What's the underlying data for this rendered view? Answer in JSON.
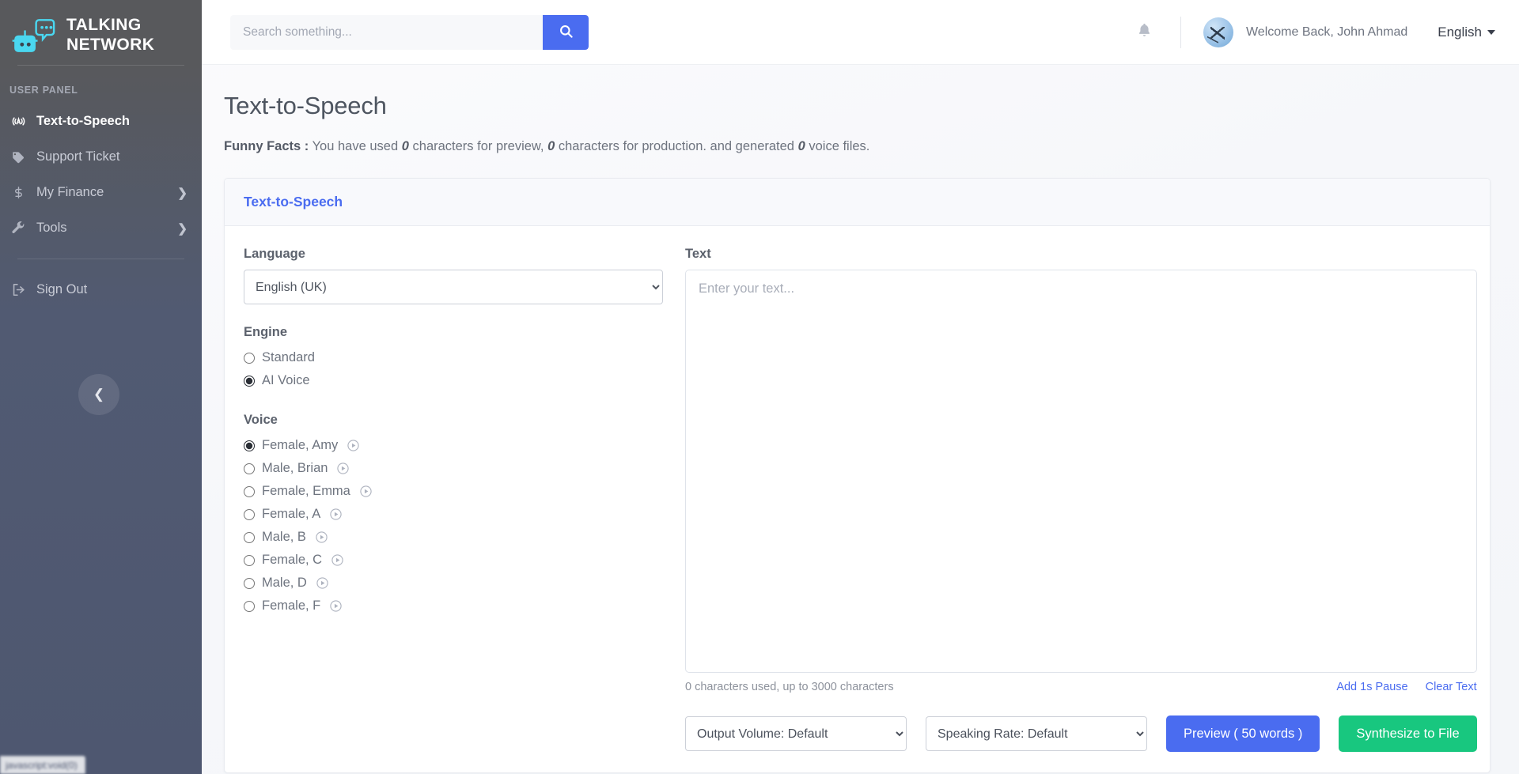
{
  "sidebar": {
    "brand": {
      "line1": "TALKING",
      "line2": "NETWORK",
      "logo_icon": "chatbot-icon"
    },
    "panel_label": "USER PANEL",
    "items": [
      {
        "label": "Text-to-Speech",
        "icon": "broadcast-a-icon",
        "active": true,
        "has_chevron": false
      },
      {
        "label": "Support Ticket",
        "icon": "tag-icon",
        "active": false,
        "has_chevron": false
      },
      {
        "label": "My Finance",
        "icon": "dollar-icon",
        "active": false,
        "has_chevron": true
      },
      {
        "label": "Tools",
        "icon": "wrench-icon",
        "active": false,
        "has_chevron": true
      }
    ],
    "signout": {
      "label": "Sign Out",
      "icon": "sign-out-icon"
    },
    "collapse_icon": "chevron-left-icon",
    "status_bar_text": "javascript:void(0)"
  },
  "topbar": {
    "search": {
      "placeholder": "Search something...",
      "value": "",
      "button_icon": "search-icon"
    },
    "bell_icon": "bell-icon",
    "welcome": "Welcome Back, John Ahmad",
    "avatar_icon": "user-avatar",
    "language": "English",
    "language_caret_icon": "caret-down-icon"
  },
  "page": {
    "title": "Text-to-Speech",
    "facts_label": "Funny Facts :",
    "facts_part1": "You have used",
    "facts_preview_count": "0",
    "facts_part2": "characters for preview,",
    "facts_production_count": "0",
    "facts_part3": "characters for production. and generated",
    "facts_files_count": "0",
    "facts_part4": "voice files."
  },
  "card": {
    "header": "Text-to-Speech",
    "language_label": "Language",
    "language_value": "English (UK)",
    "language_options": [
      "English (UK)"
    ],
    "engine_label": "Engine",
    "engines": [
      {
        "label": "Standard",
        "selected": false
      },
      {
        "label": "AI Voice",
        "selected": true
      }
    ],
    "voice_label": "Voice",
    "voices": [
      {
        "label": "Female, Amy",
        "selected": true,
        "play_icon": "play-circle-icon"
      },
      {
        "label": "Male, Brian",
        "selected": false,
        "play_icon": "play-circle-icon"
      },
      {
        "label": "Female, Emma",
        "selected": false,
        "play_icon": "play-circle-icon"
      },
      {
        "label": "Female, A",
        "selected": false,
        "play_icon": "play-circle-icon"
      },
      {
        "label": "Male, B",
        "selected": false,
        "play_icon": "play-circle-icon"
      },
      {
        "label": "Female, C",
        "selected": false,
        "play_icon": "play-circle-icon"
      },
      {
        "label": "Male, D",
        "selected": false,
        "play_icon": "play-circle-icon"
      },
      {
        "label": "Female, F",
        "selected": false,
        "play_icon": "play-circle-icon"
      }
    ],
    "text_label": "Text",
    "text_placeholder": "Enter your text...",
    "text_value": "",
    "char_counter": "0 characters used, up to 3000 characters",
    "add_pause_link": "Add 1s Pause",
    "clear_text_link": "Clear Text",
    "output_volume_value": "Output Volume: Default",
    "output_volume_options": [
      "Output Volume: Default"
    ],
    "speaking_rate_value": "Speaking Rate: Default",
    "speaking_rate_options": [
      "Speaking Rate: Default"
    ],
    "preview_button": "Preview ( 50 words )",
    "synthesize_button": "Synthesize to File"
  },
  "colors": {
    "accent_blue": "#4a6cf0",
    "accent_green": "#18c77f",
    "sidebar_top": "#58595c",
    "sidebar_bottom": "#4e5770",
    "logo_cyan": "#4ad7f0"
  }
}
